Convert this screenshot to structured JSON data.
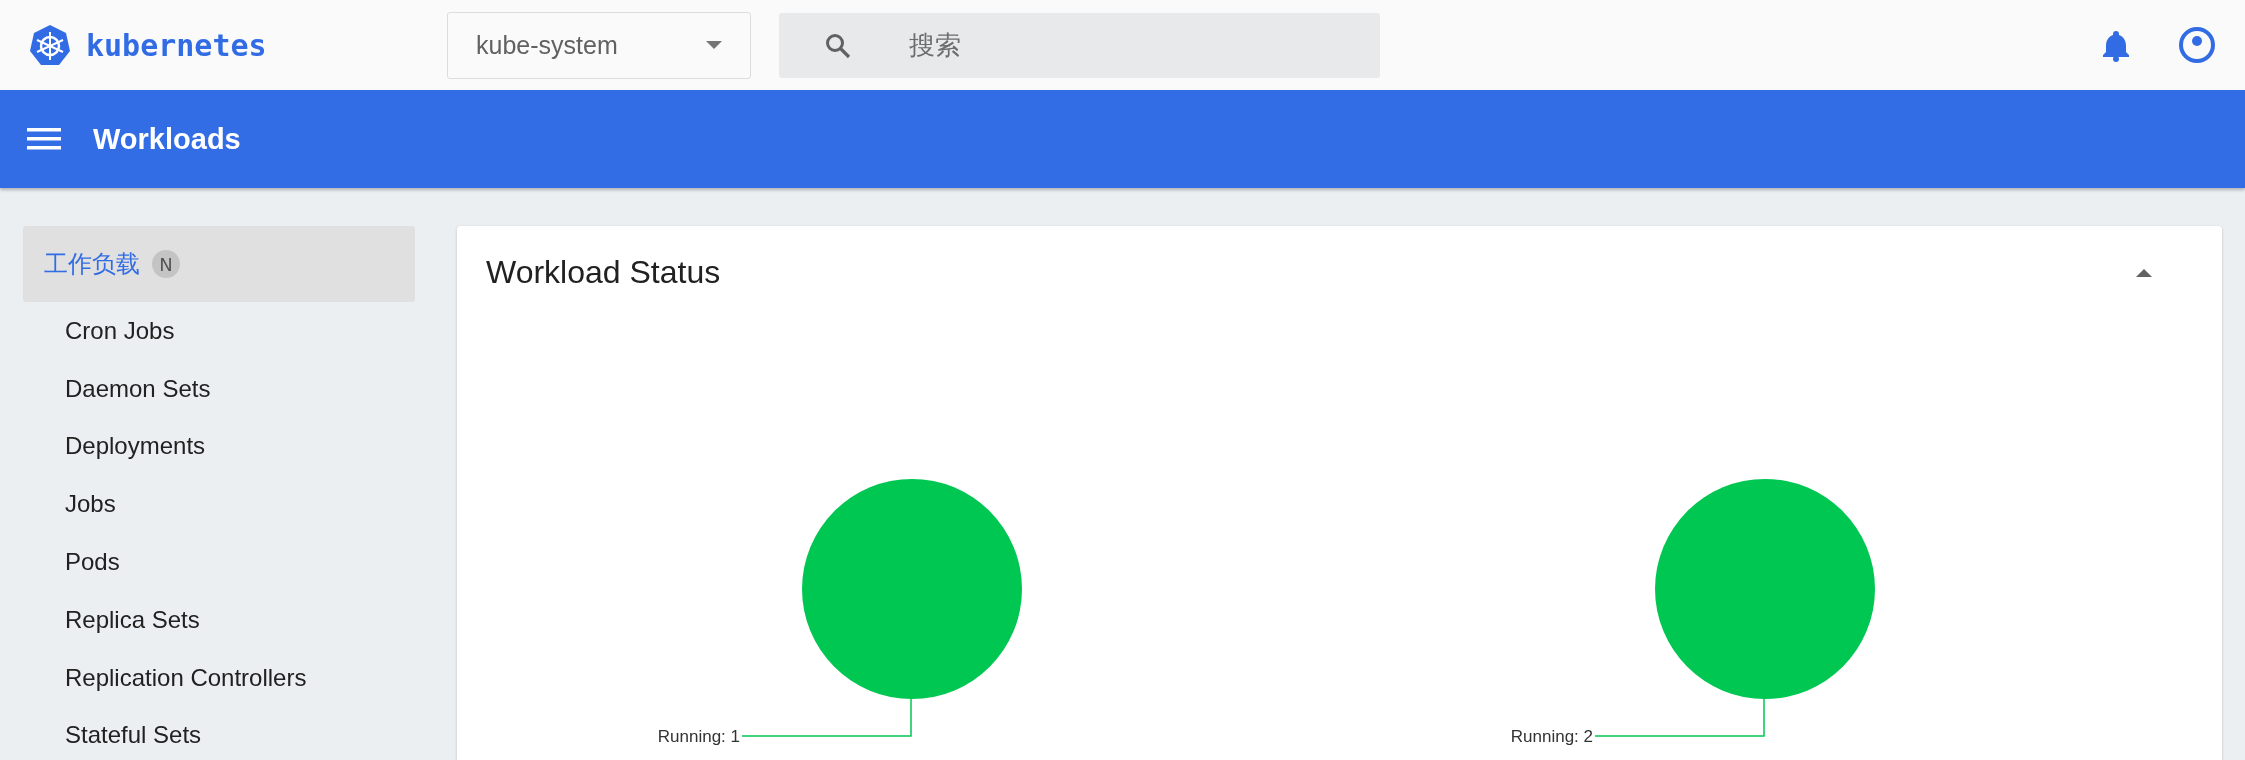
{
  "header": {
    "brand": "kubernetes",
    "namespace": "kube-system",
    "search": {
      "placeholder": "搜索"
    }
  },
  "toolbar": {
    "title": "Workloads"
  },
  "sidebar": {
    "section": {
      "label": "工作负载",
      "badge": "N",
      "selected": true
    },
    "items": [
      {
        "label": "Cron Jobs",
        "selected": false
      },
      {
        "label": "Daemon Sets",
        "selected": false
      },
      {
        "label": "Deployments",
        "selected": false
      },
      {
        "label": "Jobs",
        "selected": false
      },
      {
        "label": "Pods",
        "selected": false
      },
      {
        "label": "Replica Sets",
        "selected": false
      },
      {
        "label": "Replication Controllers",
        "selected": false
      },
      {
        "label": "Stateful Sets",
        "selected": false
      }
    ]
  },
  "card": {
    "title": "Workload Status",
    "expanded": true,
    "charts": [
      {
        "chart_data": {
          "type": "pie",
          "categories": [
            "Running: 1"
          ],
          "series": [
            {
              "color": "#00c752",
              "values": [
                100
              ]
            }
          ]
        }
      },
      {
        "chart_data": {
          "type": "pie",
          "categories": [
            "Running: 2"
          ],
          "series": [
            {
              "color": "#00c752",
              "values": [
                100
              ]
            }
          ]
        }
      }
    ]
  }
}
